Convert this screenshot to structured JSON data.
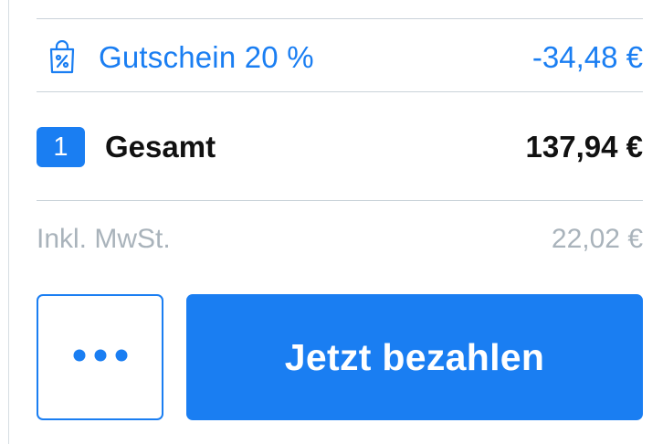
{
  "summary": {
    "coupon": {
      "icon": "shopping-bag-percent-icon",
      "label": "Gutschein 20 %",
      "amount": "-34,48 €"
    },
    "total": {
      "quantity": "1",
      "label": "Gesamt",
      "amount": "137,94 €"
    },
    "tax": {
      "label": "Inkl. MwSt.",
      "amount": "22,02 €"
    }
  },
  "actions": {
    "more_icon": "more-dots-icon",
    "pay_label": "Jetzt bezahlen"
  },
  "colors": {
    "accent": "#1a7ef2",
    "text": "#111111",
    "muted": "#a9b3bb",
    "divider": "#c9d2d9"
  }
}
